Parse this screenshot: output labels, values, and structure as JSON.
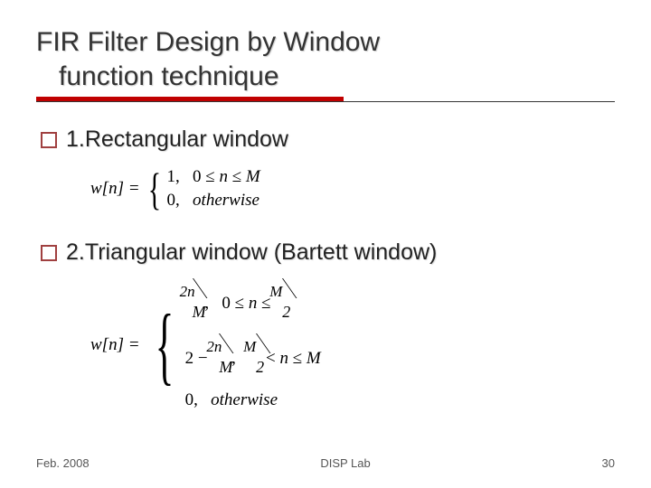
{
  "title": {
    "line1": "FIR Filter Design by Window",
    "line2": "function technique"
  },
  "bullets": {
    "b1": "1.Rectangular window",
    "b2": "2.Triangular window (Bartett window)"
  },
  "eq1": {
    "lhs": "w[n] =",
    "case1_left": "1,",
    "case1_cond": "0 ≤ n ≤ M",
    "case2_left": "0,",
    "case2_cond": "otherwise"
  },
  "eq2": {
    "lhs": "w[n] =",
    "l1_frac_num": "2n",
    "l1_frac_den": "M",
    "comma": ",",
    "l1_cond_pre": "0 ≤ n ≤",
    "half_num": "M",
    "half_den": "2",
    "l2_pre": "2 −",
    "l2_cond_pre": "",
    "lt": "< n ≤ M",
    "l3_left": "0,",
    "l3_cond": "otherwise"
  },
  "footer": {
    "left": "Feb. 2008",
    "center": "DISP Lab",
    "right": "30"
  }
}
